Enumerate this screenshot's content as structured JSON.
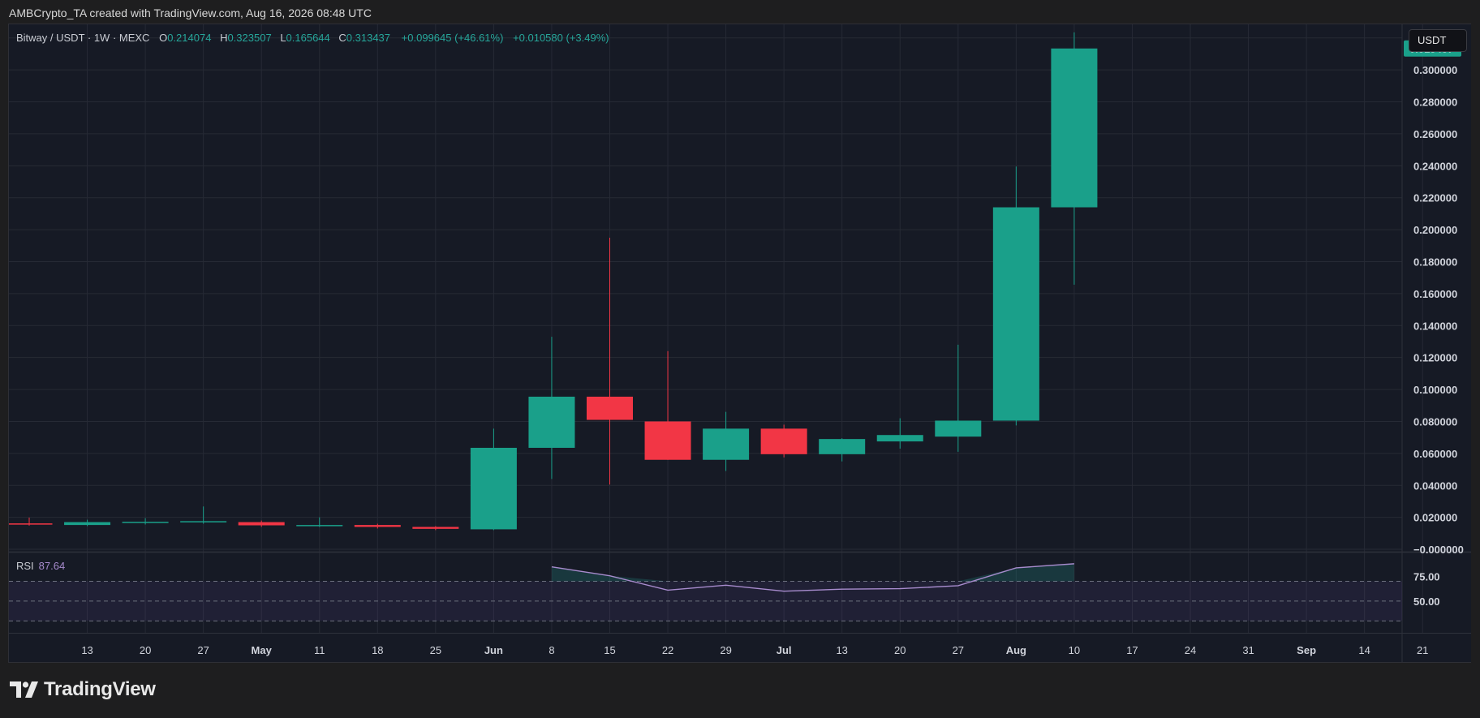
{
  "header": {
    "attribution": "AMBCrypto_TA created with TradingView.com, Aug 16, 2026 08:48 UTC"
  },
  "legend": {
    "symbol": "Bitway / USDT · 1W · MEXC",
    "open_label": "O",
    "open": "0.214074",
    "high_label": "H",
    "high": "0.323507",
    "low_label": "L",
    "low": "0.165644",
    "close_label": "C",
    "close": "0.313437",
    "change": "+0.099645 (+46.61%)",
    "change2": "+0.010580 (+3.49%)"
  },
  "currency_button": "USDT",
  "brand": "TradingView",
  "colors": {
    "background": "#161a25",
    "up": "#1aa08a",
    "down": "#f23645",
    "rsi": "#a78bcd",
    "grid": "#262a35"
  },
  "chart_data": [
    {
      "type": "candlestick",
      "interval": "1W",
      "price_axis_ticks": [
        "0.320000",
        "0.300000",
        "0.280000",
        "0.260000",
        "0.240000",
        "0.220000",
        "0.200000",
        "0.180000",
        "0.160000",
        "0.140000",
        "0.120000",
        "0.100000",
        "0.080000",
        "0.060000",
        "0.040000",
        "0.020000",
        "−0.000000"
      ],
      "ylim": [
        -0.0015,
        0.3285
      ],
      "last_price_label": "0.313437",
      "time_axis_ticks": [
        "13",
        "20",
        "27",
        "May",
        "11",
        "18",
        "25",
        "Jun",
        "8",
        "15",
        "22",
        "29",
        "Jul",
        "13",
        "20",
        "27",
        "Aug",
        "10",
        "17",
        "24",
        "31",
        "Sep",
        "14",
        "21"
      ],
      "bold_ticks": [
        "May",
        "Jun",
        "Jul",
        "Aug",
        "Sep"
      ],
      "candles": [
        {
          "x": "Apr 6",
          "o": 0.0162,
          "h": 0.0198,
          "l": 0.0148,
          "c": 0.0155
        },
        {
          "x": "Apr 13",
          "o": 0.0152,
          "h": 0.0185,
          "l": 0.0145,
          "c": 0.017
        },
        {
          "x": "Apr 20",
          "o": 0.0168,
          "h": 0.0195,
          "l": 0.0155,
          "c": 0.0172
        },
        {
          "x": "Apr 27",
          "o": 0.0172,
          "h": 0.0268,
          "l": 0.016,
          "c": 0.0176
        },
        {
          "x": "May 4",
          "o": 0.017,
          "h": 0.018,
          "l": 0.014,
          "c": 0.015
        },
        {
          "x": "May 11",
          "o": 0.015,
          "h": 0.02,
          "l": 0.014,
          "c": 0.0152
        },
        {
          "x": "May 18",
          "o": 0.0152,
          "h": 0.016,
          "l": 0.013,
          "c": 0.014
        },
        {
          "x": "May 25",
          "o": 0.014,
          "h": 0.0145,
          "l": 0.012,
          "c": 0.0128
        },
        {
          "x": "Jun 1",
          "o": 0.0125,
          "h": 0.0755,
          "l": 0.012,
          "c": 0.0635
        },
        {
          "x": "Jun 8",
          "o": 0.0635,
          "h": 0.133,
          "l": 0.044,
          "c": 0.0955
        },
        {
          "x": "Jun 15",
          "o": 0.0955,
          "h": 0.195,
          "l": 0.0405,
          "c": 0.081
        },
        {
          "x": "Jun 22",
          "o": 0.08,
          "h": 0.124,
          "l": 0.056,
          "c": 0.056
        },
        {
          "x": "Jun 29",
          "o": 0.056,
          "h": 0.086,
          "l": 0.049,
          "c": 0.0755
        },
        {
          "x": "Jul 6",
          "o": 0.0755,
          "h": 0.078,
          "l": 0.0575,
          "c": 0.0595
        },
        {
          "x": "Jul 13",
          "o": 0.0595,
          "h": 0.0695,
          "l": 0.055,
          "c": 0.069
        },
        {
          "x": "Jul 20",
          "o": 0.0675,
          "h": 0.082,
          "l": 0.063,
          "c": 0.0715
        },
        {
          "x": "Jul 27",
          "o": 0.0705,
          "h": 0.128,
          "l": 0.061,
          "c": 0.0805
        },
        {
          "x": "Aug 3",
          "o": 0.0805,
          "h": 0.2395,
          "l": 0.0775,
          "c": 0.214
        },
        {
          "x": "Aug 10",
          "o": 0.214,
          "h": 0.3235,
          "l": 0.1656,
          "c": 0.3134
        }
      ]
    },
    {
      "type": "line",
      "name": "RSI",
      "current_value": "87.64",
      "label": "RSI",
      "axis_ticks": [
        "75.00",
        "50.00"
      ],
      "band": [
        30,
        70
      ],
      "ylim": [
        18,
        99
      ],
      "points": [
        {
          "x": "Jun 8",
          "y": 84.5
        },
        {
          "x": "Jun 15",
          "y": 75.5
        },
        {
          "x": "Jun 22",
          "y": 61.0
        },
        {
          "x": "Jun 29",
          "y": 66.0
        },
        {
          "x": "Jul 6",
          "y": 60.0
        },
        {
          "x": "Jul 13",
          "y": 62.0
        },
        {
          "x": "Jul 20",
          "y": 62.5
        },
        {
          "x": "Jul 27",
          "y": 65.5
        },
        {
          "x": "Aug 3",
          "y": 83.5
        },
        {
          "x": "Aug 10",
          "y": 87.64
        }
      ]
    }
  ]
}
